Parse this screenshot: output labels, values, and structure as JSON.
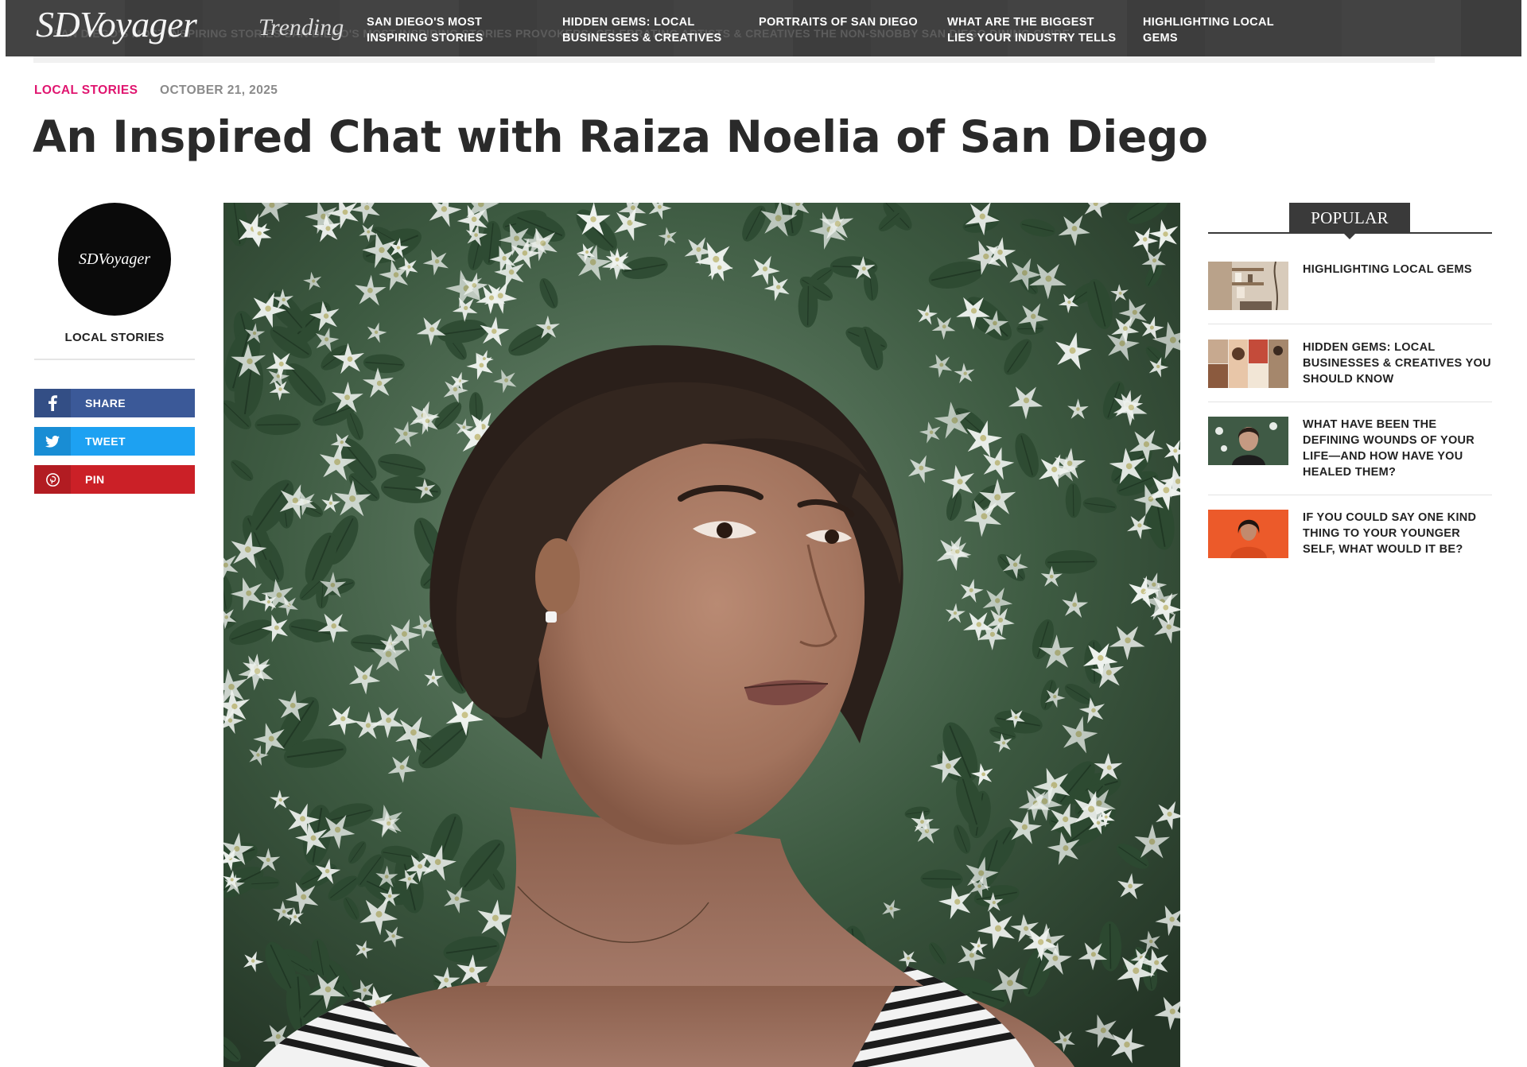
{
  "brand": {
    "logo_text": "SDVoyager",
    "trending_label": "Trending"
  },
  "nav": {
    "background_ghost_text": "SAN DIEGO'S MOST INSPIRING STORIES     SAN DIEGO'S MOST INSPIRING STORIES     PROVOKERS: CELEBRATING ARTISTS & CREATIVES     THE NON-SNOBBY SAN DIEGO DINING GUIDE",
    "items": [
      {
        "label_line1": "SAN DIEGO'S MOST",
        "label_line2": "INSPIRING STORIES"
      },
      {
        "label_line1": "HIDDEN GEMS: LOCAL",
        "label_line2": "BUSINESSES & CREATIVES"
      },
      {
        "label_line1": "PORTRAITS OF SAN DIEGO",
        "label_line2": ""
      },
      {
        "label_line1": "WHAT ARE THE BIGGEST",
        "label_line2": "LIES YOUR INDUSTRY TELLS"
      },
      {
        "label_line1": "HIGHLIGHTING LOCAL",
        "label_line2": "GEMS"
      }
    ]
  },
  "article": {
    "category": "LOCAL STORIES",
    "date": "OCTOBER 21, 2025",
    "title": "An Inspired Chat with Raiza Noelia of San Diego",
    "hero_alt": "Portrait of a woman with curly hair in front of white star jasmine flowers"
  },
  "author_box": {
    "avatar_text": "SDVoyager",
    "category_label": "LOCAL STORIES"
  },
  "share": {
    "facebook": {
      "label": "SHARE",
      "icon": "facebook-icon",
      "color": "#3b5998"
    },
    "twitter": {
      "label": "TWEET",
      "icon": "twitter-icon",
      "color": "#1da1f2"
    },
    "pinterest": {
      "label": "PIN",
      "icon": "pinterest-icon",
      "color": "#cb2027"
    }
  },
  "popular": {
    "heading": "POPULAR",
    "items": [
      {
        "title": "HIGHLIGHTING LOCAL GEMS",
        "thumb": "interior-shelves-thumbnail"
      },
      {
        "title": "HIDDEN GEMS: LOCAL BUSINESSES & CREATIVES YOU SHOULD KNOW",
        "thumb": "photo-collage-thumbnail"
      },
      {
        "title": "WHAT HAVE BEEN THE DEFINING WOUNDS OF YOUR LIFE—AND HOW HAVE YOU HEALED THEM?",
        "thumb": "woman-portrait-thumbnail"
      },
      {
        "title": "IF YOU COULD SAY ONE KIND THING TO YOUR YOUNGER SELF, WHAT WOULD IT BE?",
        "thumb": "woman-orange-background-thumbnail"
      }
    ]
  },
  "colors": {
    "accent_pink": "#e0146f",
    "nav_dark": "#3a3a3a"
  }
}
